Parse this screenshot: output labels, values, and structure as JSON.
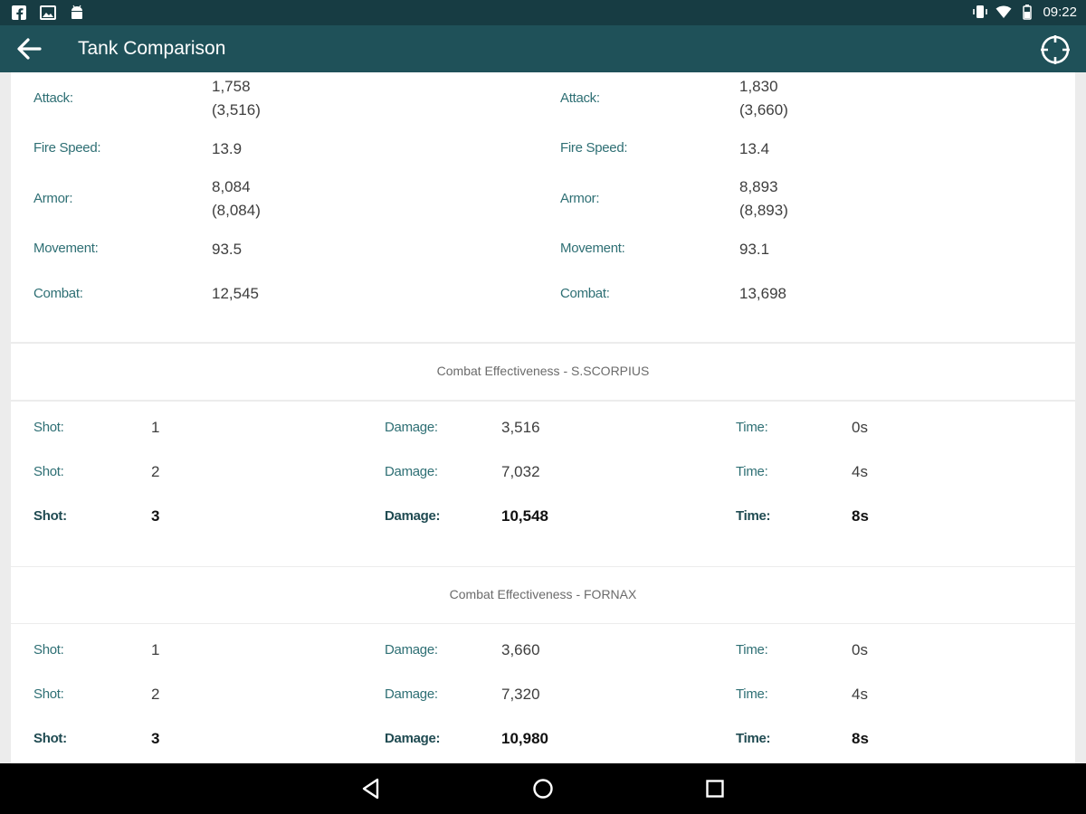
{
  "status_bar": {
    "left_icons": [
      "facebook-icon",
      "image-icon",
      "android-icon"
    ],
    "right_icons": [
      "vibrate-icon",
      "wifi-icon",
      "battery-icon"
    ],
    "time": "09:22"
  },
  "app_bar": {
    "title": "Tank Comparison",
    "back_icon": "arrow-back-icon",
    "action_icon": "crosshair-icon"
  },
  "stats": {
    "left": {
      "attack_label": "Attack:",
      "attack_value": "1,758",
      "attack_sub": "(3,516)",
      "fire_speed_label": "Fire Speed:",
      "fire_speed_value": "13.9",
      "armor_label": "Armor:",
      "armor_value": "8,084",
      "armor_sub": "(8,084)",
      "movement_label": "Movement:",
      "movement_value": "93.5",
      "combat_label": "Combat:",
      "combat_value": "12,545"
    },
    "right": {
      "attack_label": "Attack:",
      "attack_value": "1,830",
      "attack_sub": "(3,660)",
      "fire_speed_label": "Fire Speed:",
      "fire_speed_value": "13.4",
      "armor_label": "Armor:",
      "armor_value": "8,893",
      "armor_sub": "(8,893)",
      "movement_label": "Movement:",
      "movement_value": "93.1",
      "combat_label": "Combat:",
      "combat_value": "13,698"
    }
  },
  "effectiveness": [
    {
      "title": "Combat Effectiveness - S.SCORPIUS",
      "shot_label": "Shot:",
      "damage_label": "Damage:",
      "time_label": "Time:",
      "rows": [
        {
          "shot": "1",
          "damage": "3,516",
          "time": "0s"
        },
        {
          "shot": "2",
          "damage": "7,032",
          "time": "4s"
        },
        {
          "shot": "3",
          "damage": "10,548",
          "time": "8s"
        }
      ]
    },
    {
      "title": "Combat Effectiveness - FORNAX",
      "shot_label": "Shot:",
      "damage_label": "Damage:",
      "time_label": "Time:",
      "rows": [
        {
          "shot": "1",
          "damage": "3,660",
          "time": "0s"
        },
        {
          "shot": "2",
          "damage": "7,320",
          "time": "4s"
        },
        {
          "shot": "3",
          "damage": "10,980",
          "time": "8s"
        }
      ]
    }
  ],
  "nav_bar": {
    "buttons": [
      "back-triangle-icon",
      "home-circle-icon",
      "recents-square-icon"
    ]
  }
}
